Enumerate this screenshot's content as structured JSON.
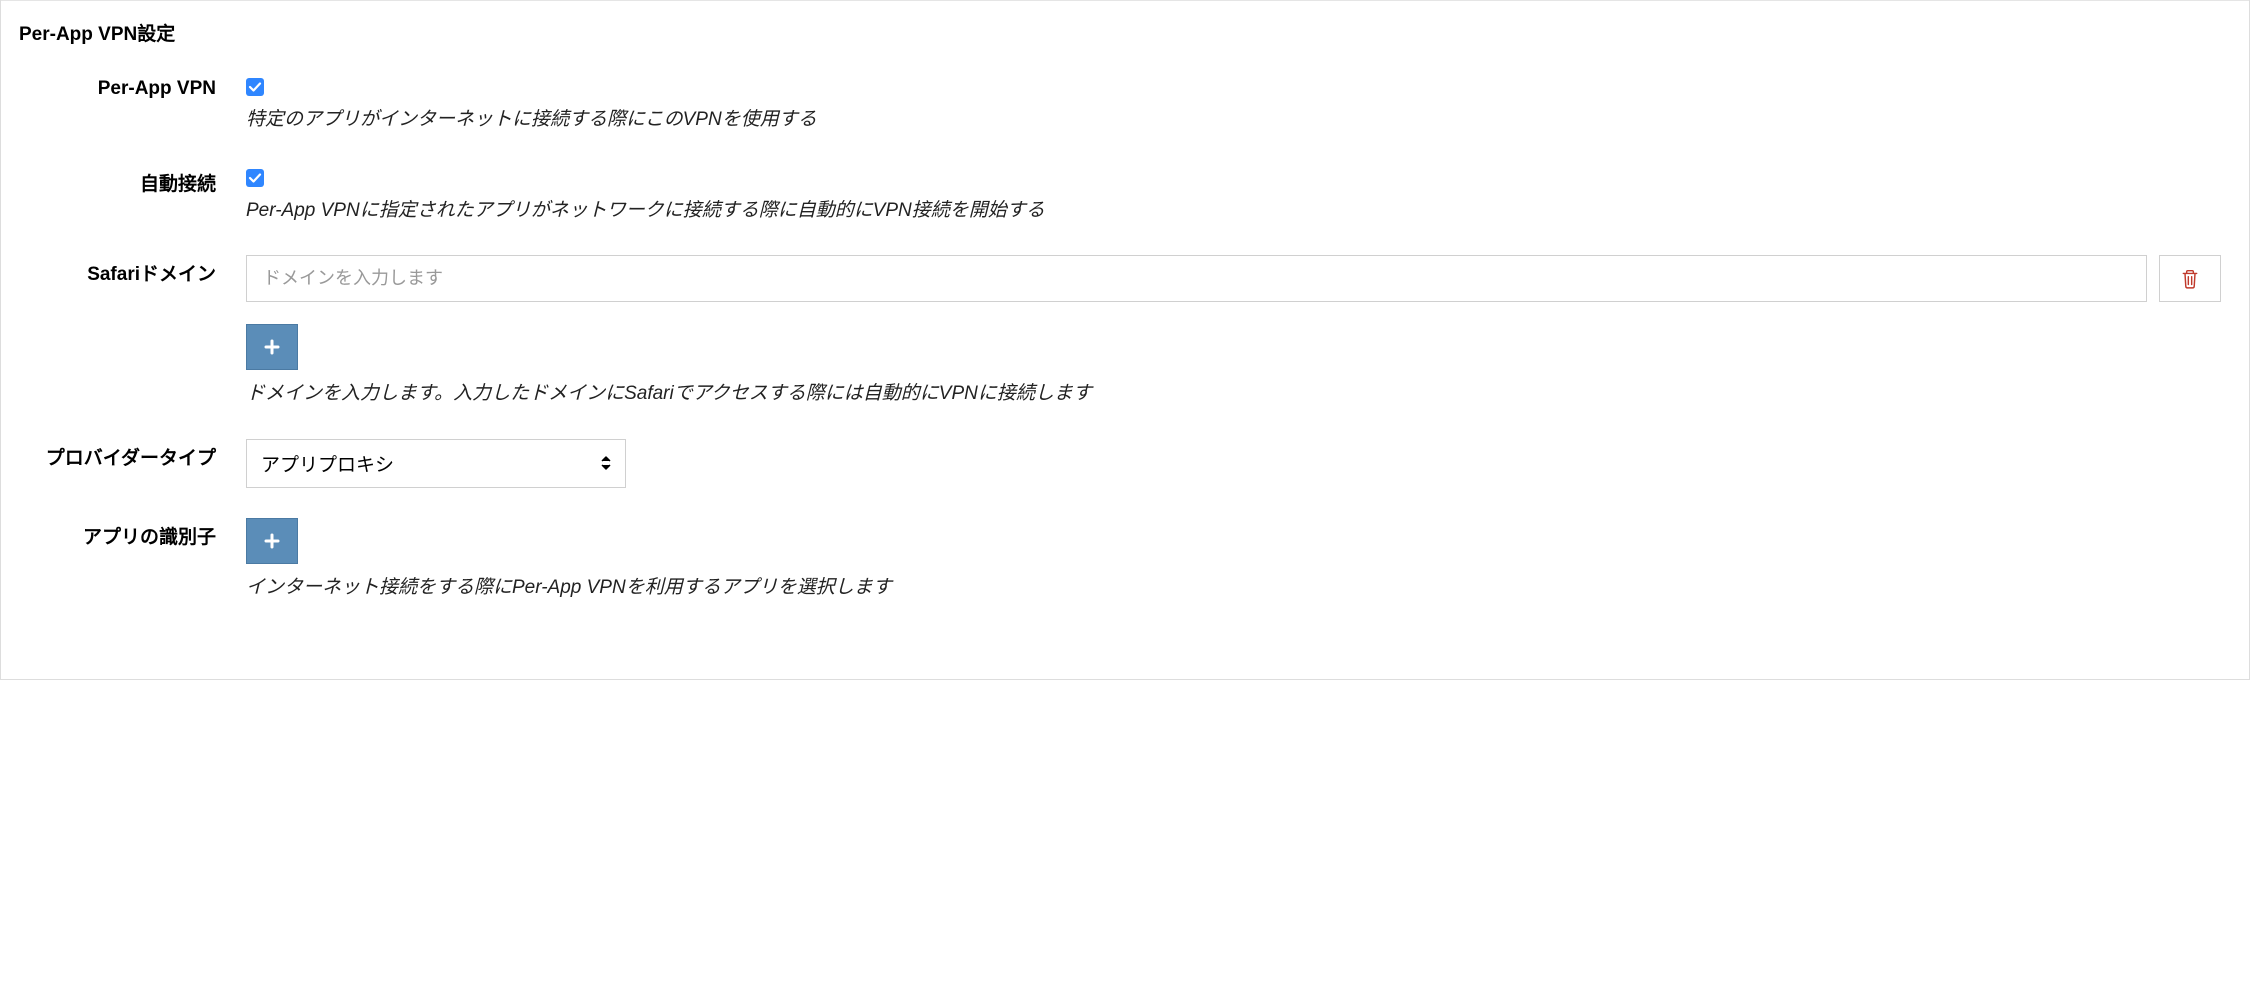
{
  "section": {
    "title": "Per-App VPN設定"
  },
  "perAppVpn": {
    "label": "Per-App VPN",
    "checked": true,
    "help": "特定のアプリがインターネットに接続する際にこのVPNを使用する"
  },
  "autoConnect": {
    "label": "自動接続",
    "checked": true,
    "help": "Per-App VPNに指定されたアプリがネットワークに接続する際に自動的にVPN接続を開始する"
  },
  "safariDomain": {
    "label": "Safariドメイン",
    "placeholder": "ドメインを入力します",
    "value": "",
    "help": "ドメインを入力します。入力したドメインにSafariでアクセスする際には自動的にVPNに接続します"
  },
  "providerType": {
    "label": "プロバイダータイプ",
    "selected": "アプリプロキシ"
  },
  "appIdentifier": {
    "label": "アプリの識別子",
    "help": "インターネット接続をする際にPer-App VPNを利用するアプリを選択します"
  }
}
